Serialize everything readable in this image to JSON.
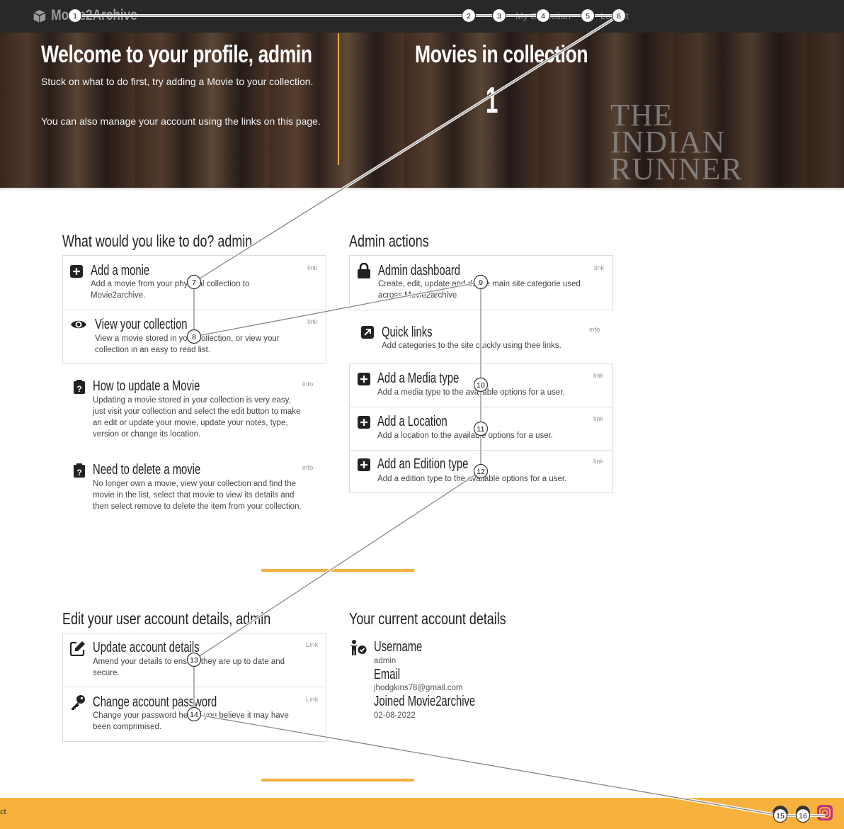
{
  "navbar": {
    "brand": "Movie2Archive",
    "links": [
      "My Collection",
      "Logout"
    ]
  },
  "hero": {
    "welcome_title": "Welcome to your profile, admin",
    "welcome_text_1": "Stuck on what to do first, try adding a Movie to your collection.",
    "welcome_text_2": "You can also manage your account using the links on this page.",
    "collection_title": "Movies in collection",
    "collection_count": "1",
    "poster_text": "THE INDIAN RUNNER"
  },
  "user_actions": {
    "title": "What would you like to do? admin",
    "items": [
      {
        "title": "Add a monie",
        "desc": "Add a movie from your physical collection to Movie2archive.",
        "tag": "link",
        "icon": "plus-square-icon"
      },
      {
        "title": "View your collection",
        "desc": "View a movie stored in your collection, or view your collection in an easy to read list.",
        "tag": "link",
        "icon": "eye-icon"
      },
      {
        "title": "How to update a Movie",
        "desc": "Updating a movie stored in your collection is very easy, just visit your collection and select the edit button to make an edit or update your movie, update your notes, type, version or change its location.",
        "tag": "info",
        "icon": "clipboard-question-icon"
      },
      {
        "title": "Need to delete a movie",
        "desc": "No longer own a movie, view your collection and find the movie in the list, select that movie to view its details and then select remove to delete the item from your collection.",
        "tag": "info",
        "icon": "clipboard-question-icon"
      }
    ]
  },
  "admin_actions": {
    "title": "Admin actions",
    "items": [
      {
        "title": "Admin dashboard",
        "desc": "Create, edit, update and delete main site categorie used across Movie2archive",
        "tag": "link",
        "icon": "lock-icon"
      },
      {
        "title": "Quick links",
        "desc": "Add categories to the site quickly using thee links.",
        "tag": "info",
        "icon": "external-link-icon"
      },
      {
        "title": "Add a Media type",
        "desc": "Add a media type to the available options for a user.",
        "tag": "link",
        "icon": "plus-square-icon"
      },
      {
        "title": "Add a Location",
        "desc": "Add a location to the available options for a user.",
        "tag": "link",
        "icon": "plus-square-icon"
      },
      {
        "title": "Add an Edition type",
        "desc": "Add a edition type to the available options for a user.",
        "tag": "link",
        "icon": "plus-square-icon"
      }
    ]
  },
  "account_edit": {
    "title": "Edit your user account details, admin",
    "items": [
      {
        "title": "Update account details",
        "desc": "Amend your details to ensure they are up to date and secure.",
        "tag": "Link",
        "icon": "edit-icon"
      },
      {
        "title": "Change account password",
        "desc": "Change your password here if you believe it may have been comprimised.",
        "tag": "Link",
        "icon": "key-icon"
      }
    ]
  },
  "account_details": {
    "title": "Your current account details",
    "username_label": "Username",
    "username": "admin",
    "email_label": "Email",
    "email": "jhodgkins78@gmail.com",
    "joined_label": "Joined Movie2archive",
    "joined": "02-08-2022"
  },
  "footer": {
    "text": "ct"
  },
  "annotations": [
    "1",
    "2",
    "3",
    "4",
    "5",
    "6",
    "7",
    "8",
    "9",
    "10",
    "11",
    "12",
    "13",
    "14",
    "15",
    "16"
  ],
  "colors": {
    "navbar": "#262829",
    "accent": "#f4b13e",
    "footer": "#f7b23d"
  }
}
